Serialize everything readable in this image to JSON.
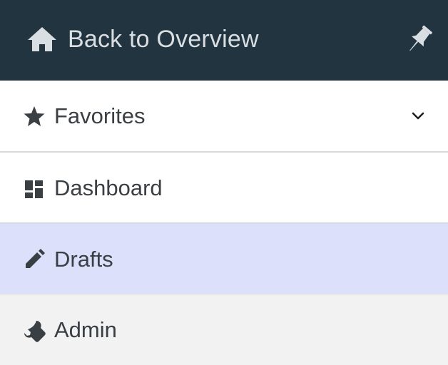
{
  "header": {
    "back_label": "Back to Overview",
    "home_icon": "home-icon",
    "pin_icon": "pin-icon",
    "background_color": "#22343f"
  },
  "menu": {
    "items": [
      {
        "label": "Favorites",
        "icon": "star-icon",
        "expandable": true,
        "expand_icon": "chevron-down-icon"
      },
      {
        "label": "Dashboard",
        "icon": "dashboard-icon"
      },
      {
        "label": "Drafts",
        "icon": "pencil-icon",
        "selected": true,
        "highlight_color": "#dce0fb"
      },
      {
        "label": "Admin",
        "icon": "wrench-icon"
      }
    ]
  }
}
